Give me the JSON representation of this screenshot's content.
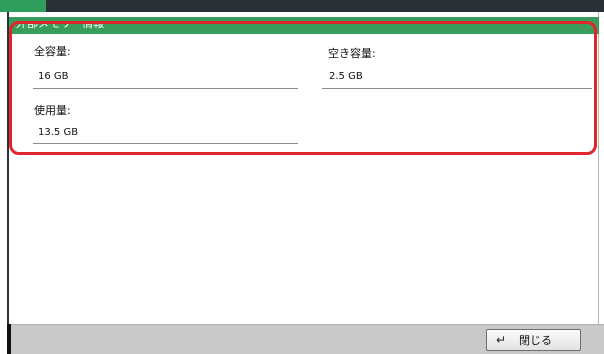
{
  "panel": {
    "title": "外部メモリー情報"
  },
  "fields": {
    "total": {
      "label": "全容量:",
      "value": "16 GB"
    },
    "free": {
      "label": "空き容量:",
      "value": "2.5 GB"
    },
    "used": {
      "label": "使用量:",
      "value": "13.5 GB"
    }
  },
  "footer": {
    "close_label": "閉じる",
    "close_icon": "enter-arrow-icon"
  },
  "colors": {
    "header_green": "#3a9c5b",
    "highlight_red": "#e0262d",
    "footer_gray": "#c9c9c9"
  }
}
